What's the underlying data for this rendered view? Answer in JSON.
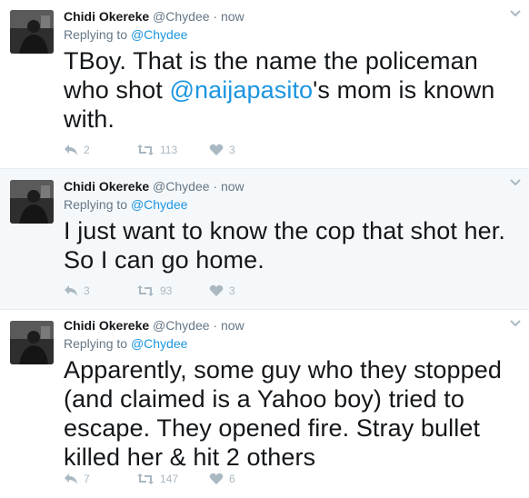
{
  "tweets": [
    {
      "name": "Chidi Okereke",
      "handle": "@Chydee",
      "separator": "·",
      "time": "now",
      "replying_prefix": "Replying to",
      "replying_to": "@Chydee",
      "text_before": "TBoy. That is the name the policeman who shot ",
      "text_link": "@naijapasito",
      "text_after": "'s mom is known with.",
      "replies": "2",
      "retweets": "113",
      "likes": "3"
    },
    {
      "name": "Chidi Okereke",
      "handle": "@Chydee",
      "separator": "·",
      "time": "now",
      "replying_prefix": "Replying to",
      "replying_to": "@Chydee",
      "text": "I just want to know the cop that shot her. So I can go home.",
      "replies": "3",
      "retweets": "93",
      "likes": "3"
    },
    {
      "name": "Chidi Okereke",
      "handle": "@Chydee",
      "separator": "·",
      "time": "now",
      "replying_prefix": "Replying to",
      "replying_to": "@Chydee",
      "text": "Apparently, some guy who they stopped (and claimed is a Yahoo boy) tried to escape. They opened fire. Stray bullet killed her & hit 2 others",
      "replies": "7",
      "retweets": "147",
      "likes": "6"
    }
  ],
  "icons": {
    "reply": "reply-arrow-icon",
    "retweet": "retweet-icon",
    "like": "heart-icon",
    "menu": "chevron-down-icon"
  },
  "colors": {
    "link": "#1b95e0",
    "muted": "#657786",
    "icon": "#aab8c2",
    "highlight_bg": "#f5f8fa"
  }
}
